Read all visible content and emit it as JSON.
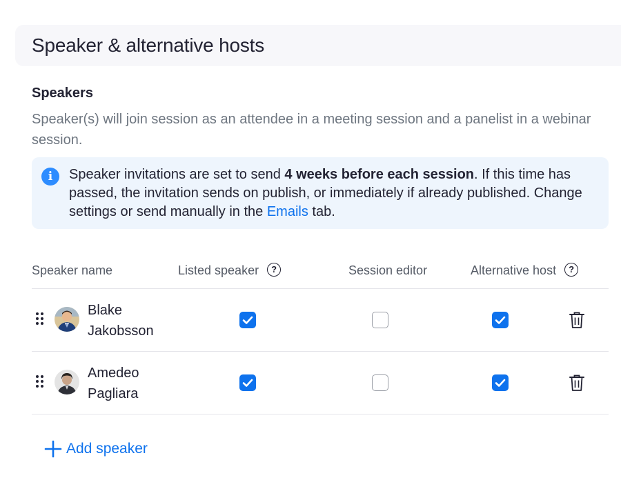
{
  "section": {
    "title": "Speaker & alternative hosts"
  },
  "speakers": {
    "heading": "Speakers",
    "description": "Speaker(s) will join session as an attendee in a meeting session and a panelist in a webinar session."
  },
  "info": {
    "icon": "info-icon",
    "text_before": "Speaker invitations are set to send ",
    "text_bold": "4 weeks before each session",
    "text_middle": ". If this time has passed, the invitation sends on publish, or immediately if already published. Change settings or send manually in the ",
    "link": "Emails",
    "text_after": " tab."
  },
  "table": {
    "columns": {
      "name": "Speaker name",
      "listed": "Listed speaker",
      "editor": "Session editor",
      "alt_host": "Alternative host"
    },
    "help_icon": "question-circle-icon",
    "rows": [
      {
        "first": "Blake",
        "last": "Jakobsson",
        "listed": true,
        "editor": false,
        "alt_host": true
      },
      {
        "first": "Amedeo",
        "last": "Pagliara",
        "listed": true,
        "editor": false,
        "alt_host": true
      }
    ]
  },
  "add_speaker": {
    "label": "Add speaker",
    "icon": "plus-icon"
  },
  "colors": {
    "accent": "#0e72ed",
    "info_bg": "#eef5fd",
    "info_icon": "#2d8cff",
    "header_bg": "#f7f7fa"
  }
}
